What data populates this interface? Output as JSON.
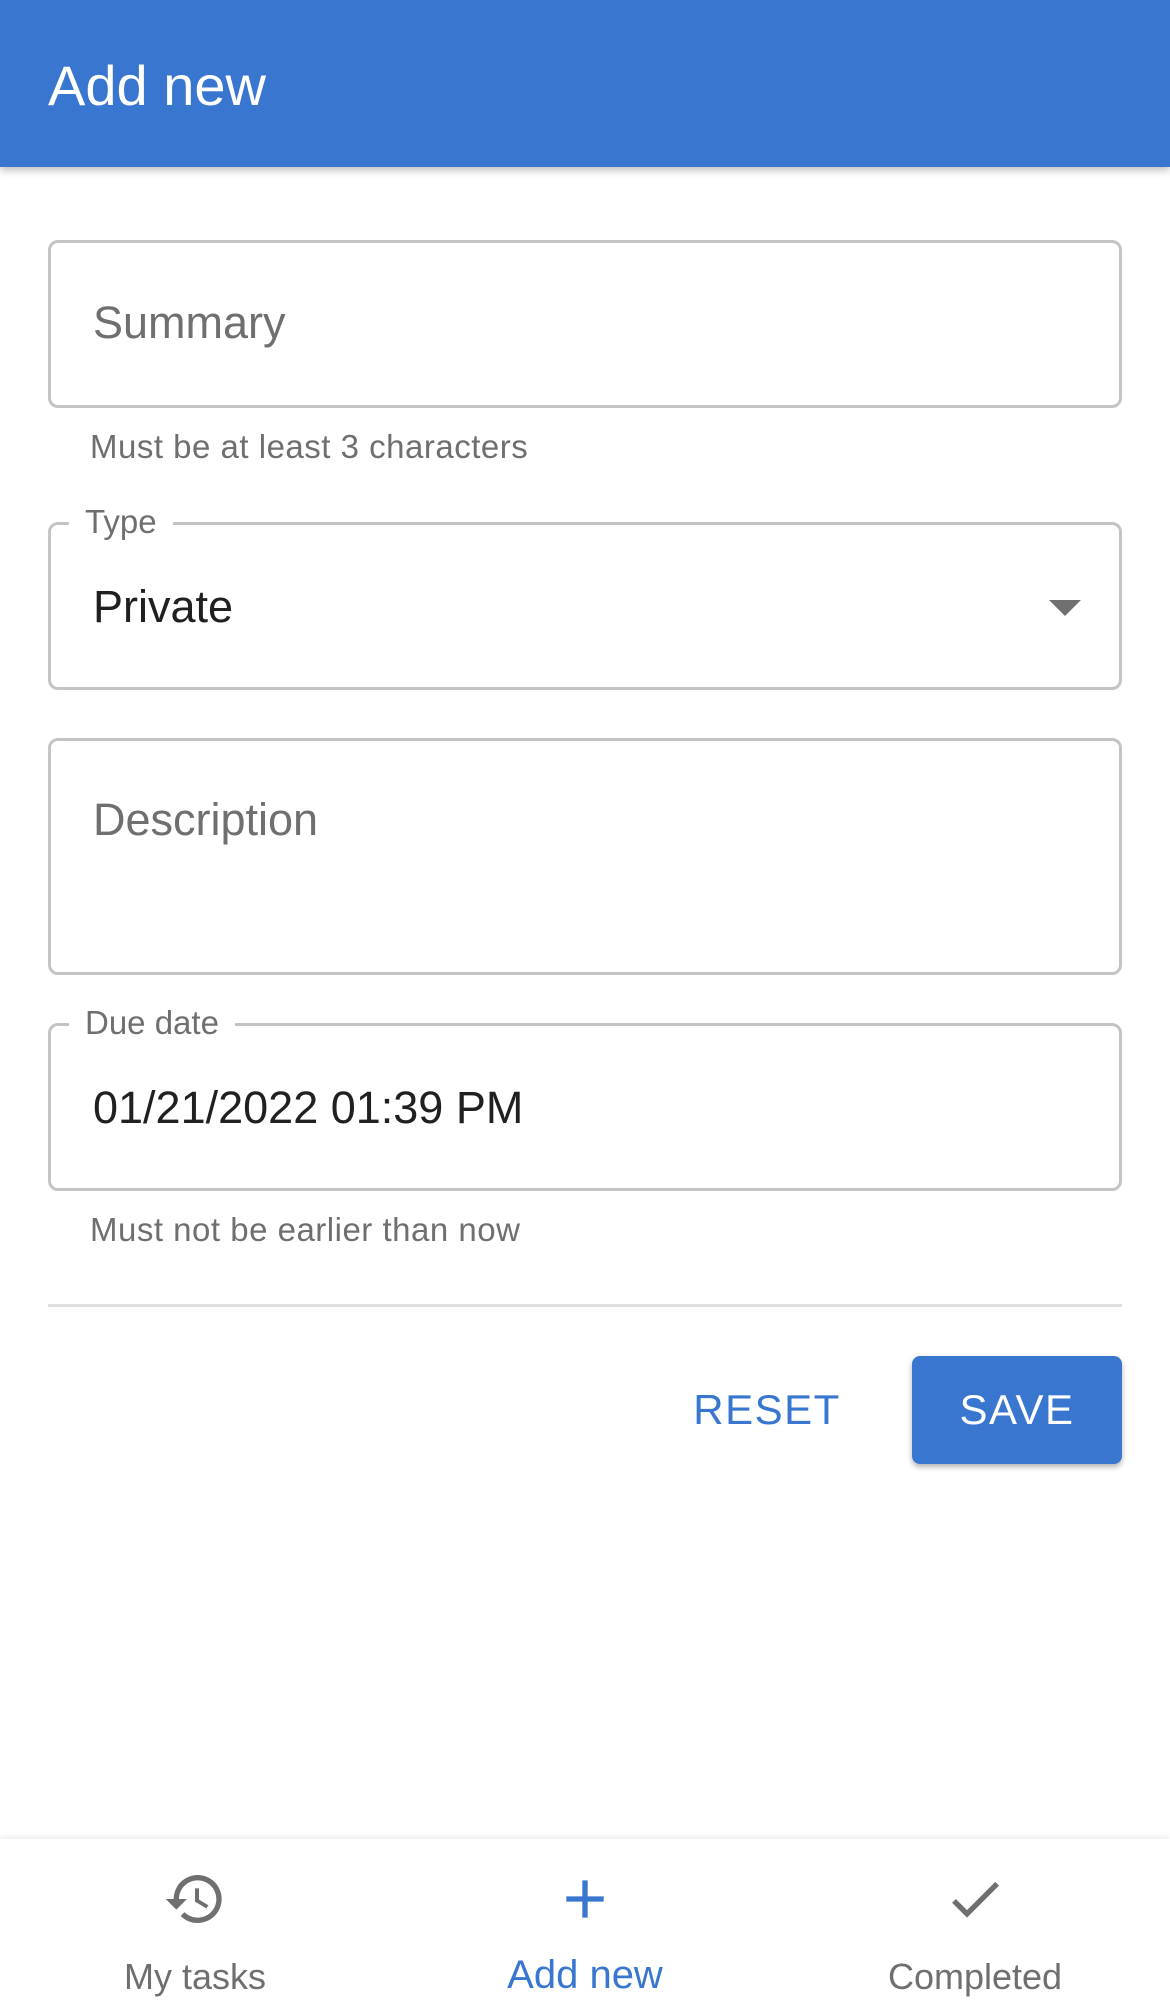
{
  "app_bar": {
    "title": "Add new"
  },
  "form": {
    "summary": {
      "placeholder": "Summary",
      "helper": "Must be at least 3 characters"
    },
    "type": {
      "label": "Type",
      "value": "Private"
    },
    "description": {
      "placeholder": "Description"
    },
    "due_date": {
      "label": "Due date",
      "value": "01/21/2022 01:39 PM",
      "helper": "Must not be earlier than now"
    },
    "actions": {
      "reset_label": "RESET",
      "save_label": "SAVE"
    }
  },
  "bottom_nav": {
    "items": [
      {
        "label": "My tasks",
        "icon": "history-icon",
        "active": false
      },
      {
        "label": "Add new",
        "icon": "plus-icon",
        "active": true
      },
      {
        "label": "Completed",
        "icon": "checkmark-icon",
        "active": false
      }
    ]
  },
  "colors": {
    "primary": "#3976d0",
    "border": "#c4c4c4",
    "secondary_text": "#6f6f6f"
  }
}
